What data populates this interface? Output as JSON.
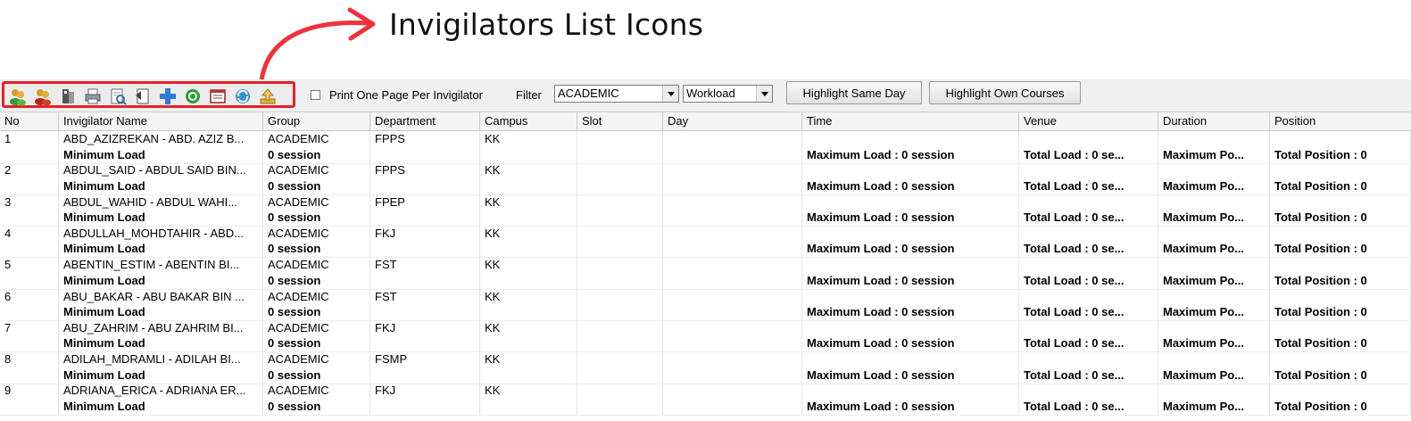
{
  "annotation": {
    "title": "Invigilators List Icons"
  },
  "toolbar": {
    "icons": [
      "add-user-icon",
      "remove-user-icon",
      "import-icon",
      "print-icon",
      "print-preview-icon",
      "edit-list-icon",
      "add-icon",
      "recycle-icon",
      "properties-icon",
      "refresh-icon",
      "upload-icon"
    ],
    "print_one_page_label": "Print One Page Per Invigilator",
    "filter_label": "Filter",
    "filter_value": "ACADEMIC",
    "workload_value": "Workload",
    "highlight_same_day_label": "Highlight Same Day",
    "highlight_own_courses_label": "Highlight Own Courses"
  },
  "table": {
    "columns": [
      "No",
      "Invigilator Name",
      "Group",
      "Department",
      "Campus",
      "Slot",
      "Day",
      "Time",
      "Venue",
      "Duration",
      "Position"
    ],
    "summary": {
      "min_label": "Minimum Load",
      "min_value": "0 session",
      "max": "Maximum Load : 0 session",
      "total": "Total Load : 0 se...",
      "max_pos": "Maximum Po...",
      "total_pos": "Total Position : 0"
    },
    "rows": [
      {
        "no": "1",
        "name": "ABD_AZIZREKAN - ABD. AZIZ B...",
        "group": "ACADEMIC",
        "department": "FPPS",
        "campus": "KK"
      },
      {
        "no": "2",
        "name": "ABDUL_SAID - ABDUL SAID BIN...",
        "group": "ACADEMIC",
        "department": "FPPS",
        "campus": "KK"
      },
      {
        "no": "3",
        "name": "ABDUL_WAHID - ABDUL WAHI...",
        "group": "ACADEMIC",
        "department": "FPEP",
        "campus": "KK"
      },
      {
        "no": "4",
        "name": "ABDULLAH_MOHDTAHIR - ABD...",
        "group": "ACADEMIC",
        "department": "FKJ",
        "campus": "KK"
      },
      {
        "no": "5",
        "name": "ABENTIN_ESTIM - ABENTIN BI...",
        "group": "ACADEMIC",
        "department": "FST",
        "campus": "KK"
      },
      {
        "no": "6",
        "name": "ABU_BAKAR - ABU BAKAR BIN ...",
        "group": "ACADEMIC",
        "department": "FST",
        "campus": "KK"
      },
      {
        "no": "7",
        "name": "ABU_ZAHRIM - ABU ZAHRIM BI...",
        "group": "ACADEMIC",
        "department": "FKJ",
        "campus": "KK"
      },
      {
        "no": "8",
        "name": "ADILAH_MDRAMLI - ADILAH BI...",
        "group": "ACADEMIC",
        "department": "FSMP",
        "campus": "KK"
      },
      {
        "no": "9",
        "name": "ADRIANA_ERICA - ADRIANA ER...",
        "group": "ACADEMIC",
        "department": "FKJ",
        "campus": "KK"
      }
    ]
  },
  "colors": {
    "highlight_border": "#e8202a",
    "arrow": "#f0313b"
  }
}
